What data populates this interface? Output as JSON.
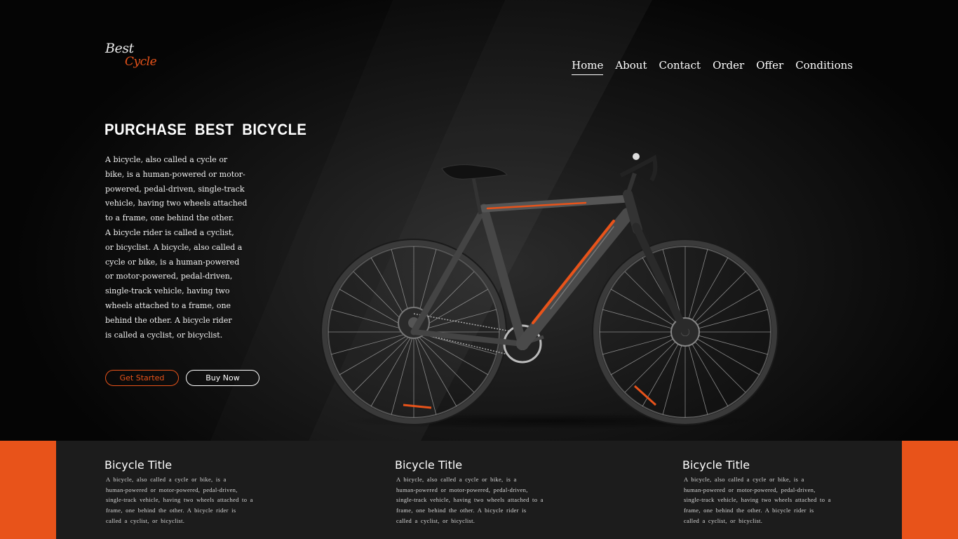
{
  "brand": {
    "logo_line1": "Best",
    "logo_line2": "Cycle"
  },
  "nav": {
    "items": [
      {
        "label": "Home",
        "active": true
      },
      {
        "label": "About"
      },
      {
        "label": "Contact"
      },
      {
        "label": "Order"
      },
      {
        "label": "Offer"
      },
      {
        "label": "Conditions"
      }
    ]
  },
  "hero": {
    "title": "PURCHASE BEST BICYCLE",
    "description_lines": [
      "A bicycle, also called a cycle or",
      "bike, is a human-powered or motor-",
      "powered, pedal-driven, single-track",
      "vehicle, having two wheels attached",
      "to a frame, one behind the other.",
      "A bicycle rider is called a cyclist,",
      "or bicyclist. A bicycle, also called a",
      "cycle or bike, is a human-powered",
      "or motor-powered, pedal-driven,",
      "single-track vehicle, having two",
      "wheels attached to a frame, one",
      "behind the other. A bicycle rider",
      "is called a cyclist, or bicyclist."
    ],
    "get_started_label": "Get Started",
    "buy_now_label": "Buy Now"
  },
  "features": [
    {
      "title": "Bicycle Title",
      "lines": [
        "A bicycle, also called a cycle or bike, is a",
        "human-powered or motor-powered, pedal-driven,",
        "single-track vehicle, having two wheels attached to a",
        "frame, one behind the other. A bicycle rider is",
        "called a cyclist, or bicyclist."
      ]
    },
    {
      "title": "Bicycle Title",
      "lines": [
        "A bicycle, also called a cycle or bike, is a",
        "human-powered or motor-powered, pedal-driven,",
        "single-track vehicle, having two wheels attached to a",
        "frame, one behind the other. A bicycle rider is",
        "called a cyclist, or bicyclist."
      ]
    },
    {
      "title": "Bicycle Title",
      "lines": [
        "A bicycle, also called a cycle or bike, is a",
        "human-powered or motor-powered, pedal-driven,",
        "single-track vehicle, having two wheels attached to a",
        "frame, one behind the other. A bicycle rider is",
        "called a cyclist, or bicyclist."
      ]
    }
  ],
  "colors": {
    "accent": "#e8531a",
    "background": "#0a0a0a",
    "panel": "#1c1c1c"
  }
}
